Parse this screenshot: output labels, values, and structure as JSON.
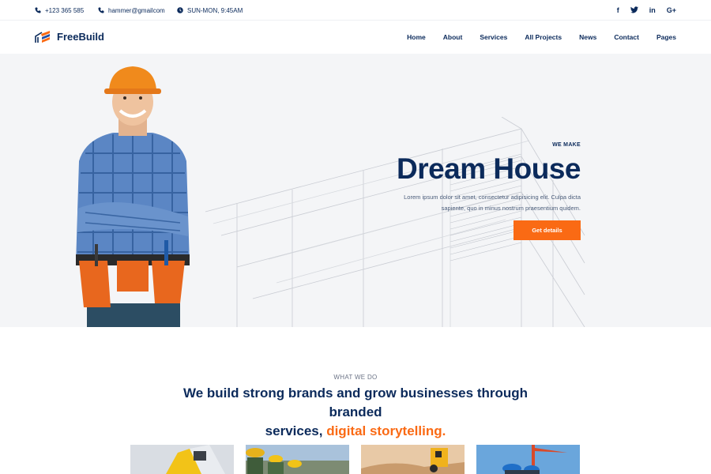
{
  "topbar": {
    "phone": "+123 365 585",
    "email": "hammer@gmailcom",
    "hours": "SUN-MON, 9:45AM",
    "social": [
      "f",
      "t",
      "in",
      "G+"
    ]
  },
  "nav": {
    "brand": "FreeBuild",
    "items": [
      "Home",
      "About",
      "Services",
      "All Projects",
      "News",
      "Contact",
      "Pages"
    ]
  },
  "hero": {
    "eyebrow": "WE MAKE",
    "title": "Dream House",
    "desc_line1": "Lorem ipsum dolor sit amet, consectetur adipisicing elit. Culpa dicta",
    "desc_line2": "sapiente, quo in minus nostrum praesentium quidem.",
    "cta": "Get details"
  },
  "what_we_do": {
    "label": "WHAT WE DO",
    "heading_line1": "We build strong brands and grow businesses through branded",
    "heading_line2_plain": "services,",
    "heading_line2_accent": "digital storytelling."
  },
  "colors": {
    "primary": "#0b2a5b",
    "accent": "#fa6a14",
    "hero_bg": "#f4f5f7"
  },
  "icons": [
    "phone-icon",
    "phone-icon",
    "clock-icon",
    "facebook-icon",
    "twitter-icon",
    "linkedin-icon",
    "google-plus-icon",
    "logo-icon"
  ]
}
